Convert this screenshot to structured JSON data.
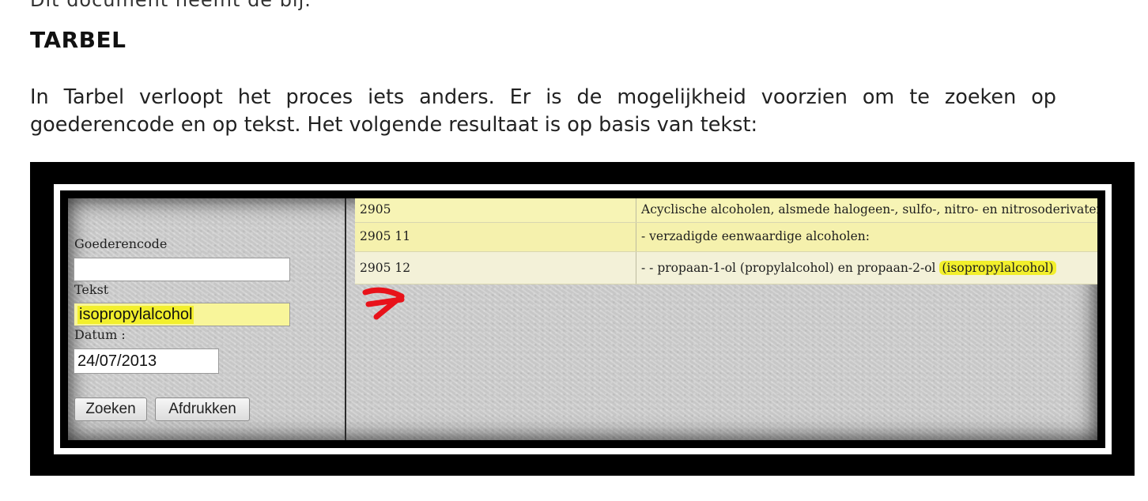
{
  "document": {
    "cutoff_line": "Dit document neemt de bij.",
    "heading": "TARBEL",
    "paragraph_line1": "In Tarbel verloopt het proces iets anders. Er is de mogelijkheid voorzien om te zoeken op",
    "paragraph_line2": "goederencode en op tekst. Het volgende resultaat is op basis van tekst:"
  },
  "form": {
    "goederencode_label": "Goederencode",
    "goederencode_value": "",
    "tekst_label": "Tekst",
    "tekst_value": "isopropylalcohol",
    "datum_label": "Datum :",
    "datum_value": "24/07/2013",
    "zoeken_label": "Zoeken",
    "afdrukken_label": "Afdrukken"
  },
  "results": {
    "rows": [
      {
        "code": "2905",
        "description": "Acyclische alcoholen, alsmede halogeen-, sulfo-, nitro- en nitrosoderivaten daarvan:"
      },
      {
        "code": "2905 11",
        "description": "- verzadigde eenwaardige alcoholen:"
      },
      {
        "code": "2905 12",
        "description_prefix": "- - propaan-1-ol (propylalcohol) en propaan-2-ol ",
        "description_highlight": "(isopropylalcohol)"
      }
    ]
  },
  "colors": {
    "highlight_yellow": "#f2ef2c",
    "arrow_red": "#e8121a",
    "row_yellow": "#f7f4b5"
  },
  "icons": {
    "annotation": "red-arrow-icon"
  }
}
